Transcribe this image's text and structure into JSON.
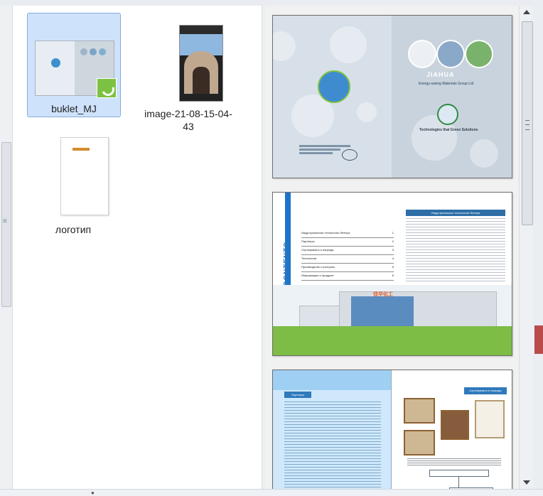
{
  "files": {
    "items": [
      {
        "label": "buklet_MJ",
        "type": "document",
        "selected": true
      },
      {
        "label": "image-21-08-15-04-43",
        "type": "image",
        "selected": false
      },
      {
        "label": "логотип",
        "type": "document",
        "selected": false
      }
    ]
  },
  "preview": {
    "cover": {
      "brand": "JIAHUA",
      "subtitle": "Energy-saving Materials Group Ltd",
      "tagline": "Technologies that Green Solutions"
    },
    "contents": {
      "title": "CONTENTS",
      "header": "Индустриальные технологии Фенхуа",
      "lines": [
        {
          "text": "Индустриальные технологии Фенхуа",
          "page": "1"
        },
        {
          "text": "Партнеры",
          "page": "2"
        },
        {
          "text": "Сертификаты и награды",
          "page": "3"
        },
        {
          "text": "Технологии",
          "page": "4"
        },
        {
          "text": "Производство и контроль",
          "page": "5"
        },
        {
          "text": "Информация о продукте",
          "page": "6"
        }
      ],
      "sign": "佳华化工"
    },
    "third_page": {
      "left_heading": "Партнеры",
      "right_heading": "Сертификаты и награды"
    }
  },
  "colors": {
    "selection_fill": "#cfe2fb",
    "selection_border": "#84acdd",
    "accent_blue": "#2f79bc",
    "accent_green": "#7cc242"
  }
}
